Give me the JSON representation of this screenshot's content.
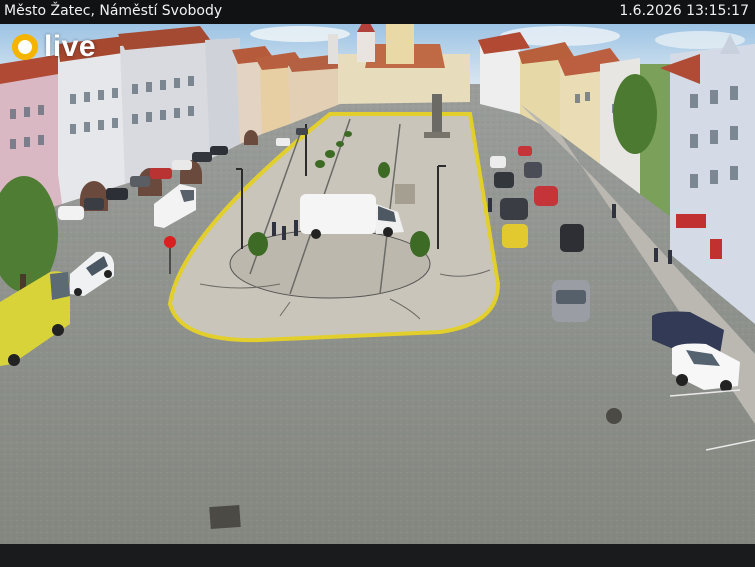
{
  "camera": {
    "title": "Město Žatec, Náměstí Svobody",
    "timestamp": "1.6.2026 13:15:17"
  },
  "logo": {
    "text": "live"
  },
  "colors": {
    "bar_background": "#111214",
    "bar_text": "#f2f2f2",
    "logo_accent": "#f4b400",
    "road": "#8b8f8c",
    "plaza": "#c9c5bb",
    "curb_yellow": "#e2cf2c"
  }
}
